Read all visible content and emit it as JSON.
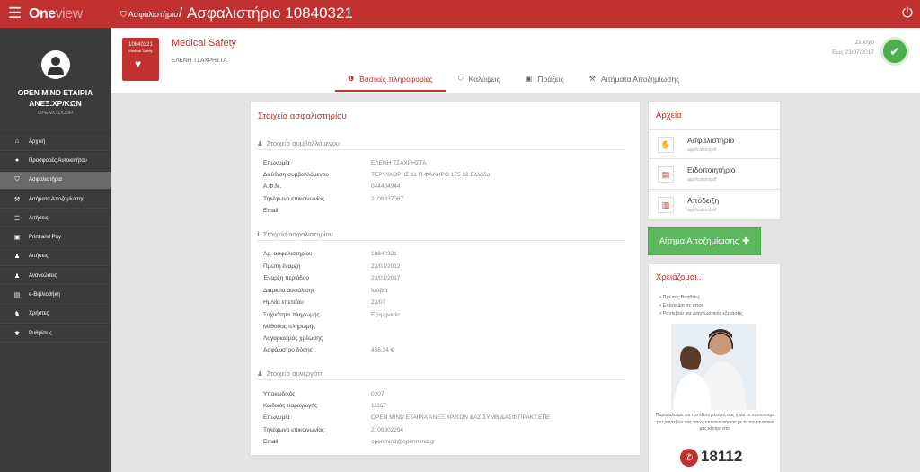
{
  "topbar": {
    "logo_main": "One",
    "logo_light": "view",
    "breadcrumb_link": "Ασφαλιστήριο",
    "breadcrumb_sep": "/",
    "page_title": "Ασφαλιστήριο 10840321"
  },
  "sidebar": {
    "company": "OPEN MIND ΕΤΑΙΡΙΑ ΑΝΕΞ.ΧΡ/ΚΩΝ",
    "company_sub": "OPENXXDOSH",
    "items": [
      {
        "label": "Αρχική",
        "icon": "home-icon"
      },
      {
        "label": "Προσφορές Αυτοκινήτου",
        "icon": "circle-icon"
      },
      {
        "label": "Ασφαλιστήρια",
        "icon": "shield-icon"
      },
      {
        "label": "Αιτήματα Αποζημίωσης",
        "icon": "gavel-icon"
      },
      {
        "label": "Αιτήσεις",
        "icon": "list-icon"
      },
      {
        "label": "Print and Pay",
        "icon": "print-icon"
      },
      {
        "label": "Αιτήσεις",
        "icon": "user-icon"
      },
      {
        "label": "Ανανεώσεις",
        "icon": "users-icon"
      },
      {
        "label": "e-Βιβλιοθήκη",
        "icon": "book-icon"
      },
      {
        "label": "Χρήστες",
        "icon": "group-icon"
      },
      {
        "label": "Ρυθμίσεις",
        "icon": "gear-icon"
      }
    ]
  },
  "policy_header": {
    "card_number": "10840321",
    "card_product": "Medical Safety",
    "product_title": "Medical Safety",
    "holder": "ΕΛΕΝΗ ΤΣΑΧΡΗΣΤΑ",
    "status_label": "Σε ισχύ",
    "status_date": "Εως 23/07/2017"
  },
  "tabs": [
    {
      "label": "Βασικές πληροφορίες",
      "icon": "info-icon"
    },
    {
      "label": "Καλύψεις",
      "icon": "shield-icon"
    },
    {
      "label": "Πράξεις",
      "icon": "image-icon"
    },
    {
      "label": "Αιτήματα Αποζημίωσης",
      "icon": "gavel-icon"
    }
  ],
  "main_panel": {
    "title": "Στοιχεία ασφαλιστηρίου",
    "section_insured": "Στοιχεία συμβαλλόμενου",
    "insured_rows": [
      {
        "label": "Επωνυμία",
        "value": "ΕΛΕΝΗ ΤΣΑΧΡΗΣΤΑ"
      },
      {
        "label": "Διεύθ/ση συμβαλλόμενου",
        "value": "ΤΕΡΨΙΧΟΡΗΣ 11 Π.ΦΑΛΗΡΟ 175 62 Ελλάδα"
      },
      {
        "label": "Α.Φ.Μ.",
        "value": "044404944"
      },
      {
        "label": "Τηλέφωνο επικοινωνίας",
        "value": "2109837067"
      },
      {
        "label": "Email",
        "value": ""
      }
    ],
    "section_policy": "Στοιχεία ασφαλιστηρίου",
    "policy_rows": [
      {
        "label": "Αρ. ασφαλιστηρίου",
        "value": "10840321"
      },
      {
        "label": "Πρώτη έναρξη",
        "value": "23/07/2012"
      },
      {
        "label": "Έναρξη περιόδου",
        "value": "23/01/2017"
      },
      {
        "label": "Διάρκεια ασφάλισης",
        "value": "Ισόβια"
      },
      {
        "label": "Ημ/νία επετείου",
        "value": "23/07"
      },
      {
        "label": "Συχνότητα πληρωμής",
        "value": "Εξαμηνιαία"
      },
      {
        "label": "Μέθοδος πληρωμής",
        "value": ""
      },
      {
        "label": "Λογαριασμός χρέωσης",
        "value": ""
      },
      {
        "label": "Ασφάλιστρο δόσης",
        "value": "456,34 €"
      }
    ],
    "section_agent": "Στοιχεία συνεργάτη",
    "agent_rows": [
      {
        "label": "Υποκωδικός",
        "value": "0207"
      },
      {
        "label": "Κωδικός παραγωγής",
        "value": "11167"
      },
      {
        "label": "Επωνυμία",
        "value": "OPEN MIND ΕΤΑΙΡΙΑ ΑΝΕΞ.ΧΡ/ΚΩΝ &ΑΣ.ΣΥΜΒ.&ΑΣΦ.ΠΡΑΚΤ.ΕΠΕ"
      },
      {
        "label": "Τηλέφωνο επικοινωνίας",
        "value": "2109802294"
      },
      {
        "label": "Email",
        "value": "openmind@openmind.gr"
      }
    ]
  },
  "files_panel": {
    "title": "Αρχεία",
    "files": [
      {
        "name": "Ασφαλιστήριο",
        "type": "application/pdf",
        "icon": "handshake-icon"
      },
      {
        "name": "Ειδοποιητήριο",
        "type": "application/pdf",
        "icon": "document-icon"
      },
      {
        "name": "Απόδειξη",
        "type": "application/pdf",
        "icon": "receipt-icon"
      }
    ]
  },
  "claim_button": "Αίτημα Αποζημίωσης",
  "help_panel": {
    "title": "Χρειάζομαι...",
    "items": [
      "Πρώτες Βοήθειες",
      "Επίσκεψη σε ιατρό",
      "Ραντεβού για διαγνωστικές εξετάσεις"
    ],
    "text": "Παρακαλούμε για την εξυπηρέτησή σας ή για το συντονισμό του ραντεβού σας όπως επικοινωνήσετε με το συντονιστικό μας κέντρο στο:",
    "phone": "18112"
  },
  "colors": {
    "brand": "#c0312f",
    "sidebar": "#3b3b3b",
    "success": "#5cb85c"
  }
}
